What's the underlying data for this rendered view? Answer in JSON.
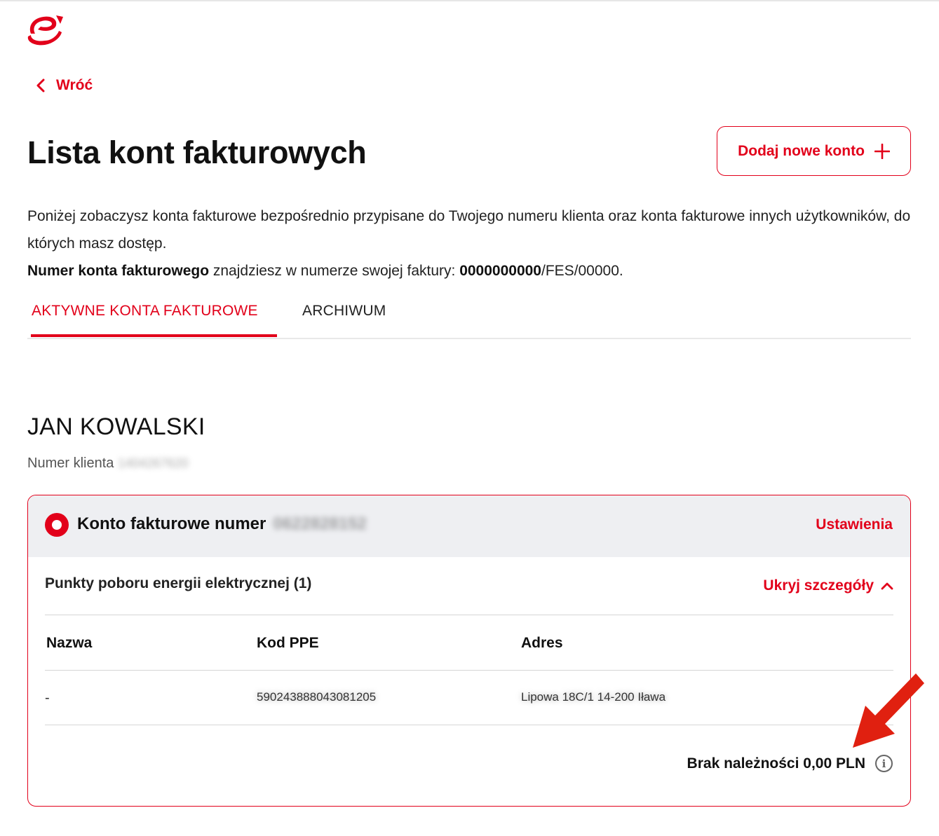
{
  "header": {
    "logo_icon": "brand-logo-icon",
    "back_label": "Wróć"
  },
  "page": {
    "title": "Lista kont fakturowych",
    "add_button_label": "Dodaj nowe konto",
    "description_line1": "Poniżej zobaczysz konta fakturowe bezpośrednio przypisane do Twojego numeru klienta oraz konta fakturowe innych użytkowników, do których masz dostęp.",
    "description_bold": "Numer konta fakturowego",
    "description_mid": " znajdziesz w numerze swojej faktury: ",
    "description_number_bold": "0000000000",
    "description_suffix": "/FES/00000."
  },
  "tabs": [
    {
      "label": "AKTYWNE KONTA FAKTUROWE",
      "active": true
    },
    {
      "label": "ARCHIWUM",
      "active": false
    }
  ],
  "client": {
    "name": "JAN KOWALSKI",
    "number_label": "Numer klienta",
    "number_value": "1404267620"
  },
  "account": {
    "label": "Konto fakturowe numer",
    "number_value": "0622828152",
    "settings_label": "Ustawienia",
    "ppe_title": "Punkty poboru energii elektrycznej (1)",
    "toggle_label": "Ukryj szczegóły",
    "columns": [
      "Nazwa",
      "Kod PPE",
      "Adres"
    ],
    "rows": [
      {
        "name": "-",
        "ppe_code": "590243888043081205",
        "address": "Lipowa 18C/1 14-200 Iława"
      }
    ],
    "balance_label": "Brak należności 0,00 PLN"
  },
  "colors": {
    "accent": "#e2001a",
    "header_bg": "#eeeff2",
    "annotation_arrow": "#e02010"
  }
}
